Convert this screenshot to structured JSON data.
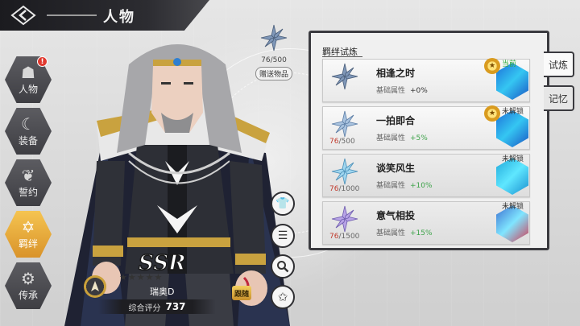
{
  "header": {
    "title": "人物"
  },
  "nav": {
    "items": [
      {
        "label": "人物",
        "icon": "mask-icon",
        "alert": "!"
      },
      {
        "label": "装备",
        "icon": "moon-icon"
      },
      {
        "label": "誓约",
        "icon": "lotus-icon"
      },
      {
        "label": "羁绊",
        "icon": "star-of-david-icon",
        "active": true
      },
      {
        "label": "传承",
        "icon": "gear-icon"
      }
    ]
  },
  "gift": {
    "progress": "76/500",
    "label": "赠送物品"
  },
  "character": {
    "rarity": "SSR",
    "stars": "★★★★★",
    "name": "瑞奥D",
    "score_label": "综合评分",
    "score_value": "737",
    "follow_tag": "跟随"
  },
  "side_actions": [
    "shirt-icon",
    "list-icon",
    "magnifier-icon",
    "star-icon"
  ],
  "bond_panel": {
    "title": "羁绊试炼",
    "rows": [
      {
        "name": "相逢之时",
        "progress_cur": "",
        "progress_total": "",
        "attr_label": "基础属性",
        "attr_value": "+0%",
        "status": "当前"
      },
      {
        "name": "一拍即合",
        "progress_cur": "76",
        "progress_total": "/500",
        "attr_label": "基础属性",
        "attr_value": "+5%",
        "status": "未解锁"
      },
      {
        "name": "谈笑风生",
        "progress_cur": "76",
        "progress_total": "/1000",
        "attr_label": "基础属性",
        "attr_value": "+10%",
        "status": "未解锁"
      },
      {
        "name": "意气相投",
        "progress_cur": "76",
        "progress_total": "/1500",
        "attr_label": "基础属性",
        "attr_value": "+15%",
        "status": "未解锁"
      }
    ]
  },
  "right_tabs": [
    {
      "label": "试炼",
      "active": true
    },
    {
      "label": "记忆",
      "active": false
    }
  ]
}
